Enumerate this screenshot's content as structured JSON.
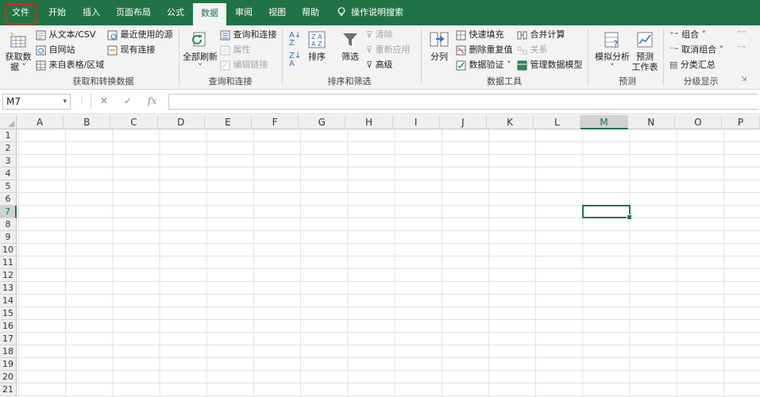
{
  "menu": {
    "tabs": [
      {
        "label": "文件"
      },
      {
        "label": "开始"
      },
      {
        "label": "插入"
      },
      {
        "label": "页面布局"
      },
      {
        "label": "公式"
      },
      {
        "label": "数据"
      },
      {
        "label": "审阅"
      },
      {
        "label": "视图"
      },
      {
        "label": "帮助"
      }
    ],
    "tell_me": "操作说明搜索",
    "active_tab": "数据"
  },
  "ribbon": {
    "get_transform": {
      "get_data": "获取数据",
      "get_data_line1": "获取数",
      "get_data_line2": "据",
      "from_text_csv": "从文本/CSV",
      "from_web": "自网站",
      "from_table": "来自表格/区域",
      "recent_sources": "最近使用的源",
      "existing_connections": "现有连接",
      "group_label": "获取和转换数据"
    },
    "queries": {
      "refresh_all": "全部刷新",
      "queries_connections": "查询和连接",
      "properties": "属性",
      "edit_links": "编辑链接",
      "group_label": "查询和连接"
    },
    "sort_filter": {
      "sort": "排序",
      "filter": "筛选",
      "clear": "清除",
      "reapply": "重新应用",
      "advanced": "高级",
      "group_label": "排序和筛选"
    },
    "data_tools": {
      "text_to_columns": "分列",
      "flash_fill": "快速填充",
      "remove_duplicates": "删除重复值",
      "data_validation": "数据验证",
      "consolidate": "合并计算",
      "relationships": "关系",
      "manage_data_model": "管理数据模型",
      "group_label": "数据工具"
    },
    "forecast": {
      "what_if": "模拟分析",
      "forecast_sheet_line1": "预测",
      "forecast_sheet_line2": "工作表",
      "group_label": "预测"
    },
    "outline": {
      "group": "组合",
      "ungroup": "取消组合",
      "subtotal": "分类汇总",
      "group_label": "分级显示"
    }
  },
  "formula_bar": {
    "name_box": "M7",
    "cancel": "✕",
    "enter": "✓",
    "fx": "fx",
    "content": ""
  },
  "sheet": {
    "columns": [
      "A",
      "B",
      "C",
      "D",
      "E",
      "F",
      "G",
      "H",
      "I",
      "J",
      "K",
      "L",
      "M",
      "N",
      "O",
      "P"
    ],
    "rows": [
      "1",
      "2",
      "3",
      "4",
      "5",
      "6",
      "7",
      "8",
      "9",
      "10",
      "11",
      "12",
      "13",
      "14",
      "15",
      "16",
      "17",
      "18",
      "19",
      "20",
      "21"
    ],
    "selected_cell": "M7",
    "accent": "#217346"
  }
}
